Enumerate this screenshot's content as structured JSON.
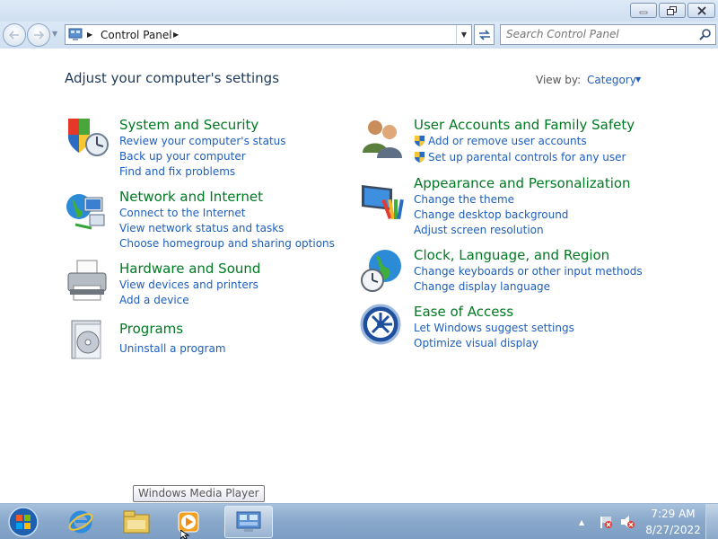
{
  "window": {
    "minimize_label": "minimize",
    "maximize_label": "restore",
    "close_label": "close"
  },
  "address_bar": {
    "path": "Control Panel",
    "search_placeholder": "Search Control Panel"
  },
  "header": {
    "title": "Adjust your computer's settings",
    "view_by_label": "View by:",
    "view_by_value": "Category"
  },
  "categories": [
    {
      "title": "System and Security",
      "icon": "security-shield-icon",
      "links": [
        "Review your computer's status",
        "Back up your computer",
        "Find and fix problems"
      ]
    },
    {
      "title": "Network and Internet",
      "icon": "network-globe-icon",
      "links": [
        "Connect to the Internet",
        "View network status and tasks",
        "Choose homegroup and sharing options"
      ]
    },
    {
      "title": "Hardware and Sound",
      "icon": "printer-icon",
      "links": [
        "View devices and printers",
        "Add a device"
      ]
    },
    {
      "title": "Programs",
      "icon": "programs-disc-icon",
      "links": [
        "Uninstall a program"
      ]
    },
    {
      "title": "User Accounts and Family Safety",
      "icon": "users-icon",
      "links": [
        "Add or remove user accounts",
        "Set up parental controls for any user"
      ]
    },
    {
      "title": "Appearance and Personalization",
      "icon": "display-palette-icon",
      "links": [
        "Change the theme",
        "Change desktop background",
        "Adjust screen resolution"
      ]
    },
    {
      "title": "Clock, Language, and Region",
      "icon": "clock-globe-icon",
      "links": [
        "Change keyboards or other input methods",
        "Change display language"
      ]
    },
    {
      "title": "Ease of Access",
      "icon": "ease-of-access-icon",
      "links": [
        "Let Windows suggest settings",
        "Optimize visual display"
      ]
    }
  ],
  "taskbar": {
    "tooltip": "Windows Media Player",
    "clock_time": "7:29 AM",
    "clock_date": "8/27/2022"
  },
  "colors": {
    "category_title": "#007a22",
    "link": "#1e5ebd",
    "heading": "#1e395b",
    "taskbar": "#8aa9cb"
  }
}
